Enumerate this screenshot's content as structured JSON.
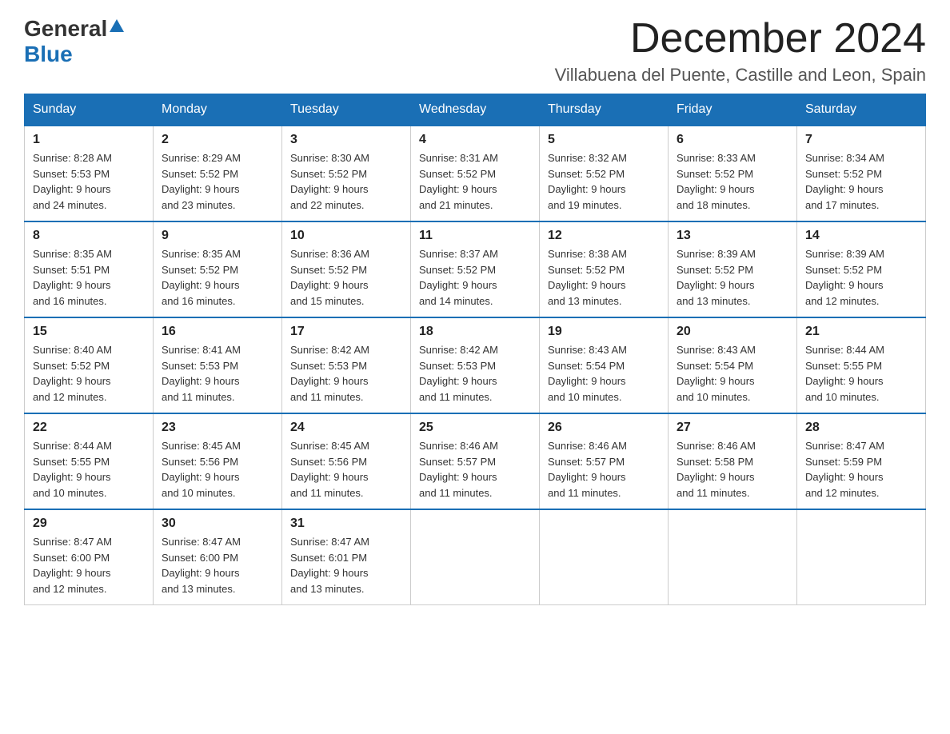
{
  "header": {
    "logo_line1": "General",
    "logo_line2": "Blue",
    "month_title": "December 2024",
    "subtitle": "Villabuena del Puente, Castille and Leon, Spain"
  },
  "calendar": {
    "weekdays": [
      "Sunday",
      "Monday",
      "Tuesday",
      "Wednesday",
      "Thursday",
      "Friday",
      "Saturday"
    ],
    "weeks": [
      [
        {
          "day": "1",
          "sunrise": "8:28 AM",
          "sunset": "5:53 PM",
          "daylight": "9 hours and 24 minutes."
        },
        {
          "day": "2",
          "sunrise": "8:29 AM",
          "sunset": "5:52 PM",
          "daylight": "9 hours and 23 minutes."
        },
        {
          "day": "3",
          "sunrise": "8:30 AM",
          "sunset": "5:52 PM",
          "daylight": "9 hours and 22 minutes."
        },
        {
          "day": "4",
          "sunrise": "8:31 AM",
          "sunset": "5:52 PM",
          "daylight": "9 hours and 21 minutes."
        },
        {
          "day": "5",
          "sunrise": "8:32 AM",
          "sunset": "5:52 PM",
          "daylight": "9 hours and 19 minutes."
        },
        {
          "day": "6",
          "sunrise": "8:33 AM",
          "sunset": "5:52 PM",
          "daylight": "9 hours and 18 minutes."
        },
        {
          "day": "7",
          "sunrise": "8:34 AM",
          "sunset": "5:52 PM",
          "daylight": "9 hours and 17 minutes."
        }
      ],
      [
        {
          "day": "8",
          "sunrise": "8:35 AM",
          "sunset": "5:51 PM",
          "daylight": "9 hours and 16 minutes."
        },
        {
          "day": "9",
          "sunrise": "8:35 AM",
          "sunset": "5:52 PM",
          "daylight": "9 hours and 16 minutes."
        },
        {
          "day": "10",
          "sunrise": "8:36 AM",
          "sunset": "5:52 PM",
          "daylight": "9 hours and 15 minutes."
        },
        {
          "day": "11",
          "sunrise": "8:37 AM",
          "sunset": "5:52 PM",
          "daylight": "9 hours and 14 minutes."
        },
        {
          "day": "12",
          "sunrise": "8:38 AM",
          "sunset": "5:52 PM",
          "daylight": "9 hours and 13 minutes."
        },
        {
          "day": "13",
          "sunrise": "8:39 AM",
          "sunset": "5:52 PM",
          "daylight": "9 hours and 13 minutes."
        },
        {
          "day": "14",
          "sunrise": "8:39 AM",
          "sunset": "5:52 PM",
          "daylight": "9 hours and 12 minutes."
        }
      ],
      [
        {
          "day": "15",
          "sunrise": "8:40 AM",
          "sunset": "5:52 PM",
          "daylight": "9 hours and 12 minutes."
        },
        {
          "day": "16",
          "sunrise": "8:41 AM",
          "sunset": "5:53 PM",
          "daylight": "9 hours and 11 minutes."
        },
        {
          "day": "17",
          "sunrise": "8:42 AM",
          "sunset": "5:53 PM",
          "daylight": "9 hours and 11 minutes."
        },
        {
          "day": "18",
          "sunrise": "8:42 AM",
          "sunset": "5:53 PM",
          "daylight": "9 hours and 11 minutes."
        },
        {
          "day": "19",
          "sunrise": "8:43 AM",
          "sunset": "5:54 PM",
          "daylight": "9 hours and 10 minutes."
        },
        {
          "day": "20",
          "sunrise": "8:43 AM",
          "sunset": "5:54 PM",
          "daylight": "9 hours and 10 minutes."
        },
        {
          "day": "21",
          "sunrise": "8:44 AM",
          "sunset": "5:55 PM",
          "daylight": "9 hours and 10 minutes."
        }
      ],
      [
        {
          "day": "22",
          "sunrise": "8:44 AM",
          "sunset": "5:55 PM",
          "daylight": "9 hours and 10 minutes."
        },
        {
          "day": "23",
          "sunrise": "8:45 AM",
          "sunset": "5:56 PM",
          "daylight": "9 hours and 10 minutes."
        },
        {
          "day": "24",
          "sunrise": "8:45 AM",
          "sunset": "5:56 PM",
          "daylight": "9 hours and 11 minutes."
        },
        {
          "day": "25",
          "sunrise": "8:46 AM",
          "sunset": "5:57 PM",
          "daylight": "9 hours and 11 minutes."
        },
        {
          "day": "26",
          "sunrise": "8:46 AM",
          "sunset": "5:57 PM",
          "daylight": "9 hours and 11 minutes."
        },
        {
          "day": "27",
          "sunrise": "8:46 AM",
          "sunset": "5:58 PM",
          "daylight": "9 hours and 11 minutes."
        },
        {
          "day": "28",
          "sunrise": "8:47 AM",
          "sunset": "5:59 PM",
          "daylight": "9 hours and 12 minutes."
        }
      ],
      [
        {
          "day": "29",
          "sunrise": "8:47 AM",
          "sunset": "6:00 PM",
          "daylight": "9 hours and 12 minutes."
        },
        {
          "day": "30",
          "sunrise": "8:47 AM",
          "sunset": "6:00 PM",
          "daylight": "9 hours and 13 minutes."
        },
        {
          "day": "31",
          "sunrise": "8:47 AM",
          "sunset": "6:01 PM",
          "daylight": "9 hours and 13 minutes."
        },
        null,
        null,
        null,
        null
      ]
    ]
  }
}
